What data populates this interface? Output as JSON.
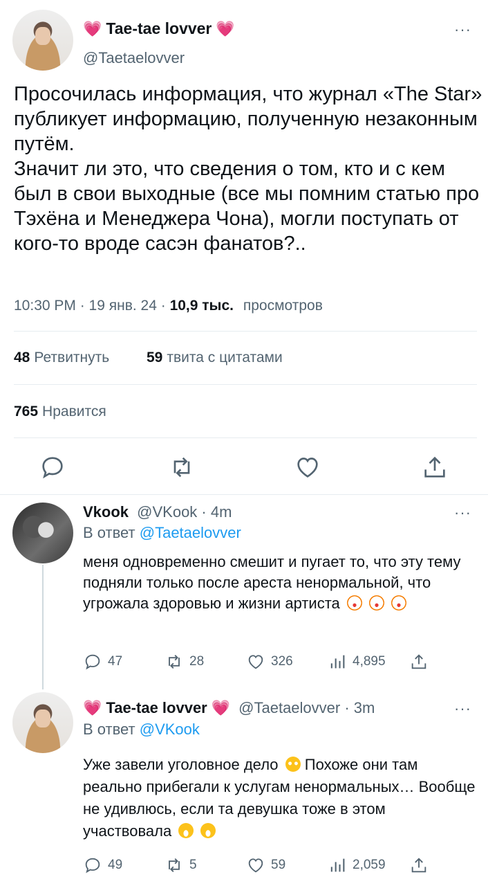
{
  "tweet": {
    "author_name": "Tae-tae lovver",
    "author_handle": "@Taetaelovver",
    "heart_left": "💗",
    "heart_right": "💗",
    "more": "···",
    "text": "Просочилась информация, что журнал «The Star» публикует информацию, полученную незаконным путём.\nЗначит ли это, что сведения о том, кто и с кем был в свои выходные (все мы помним статью про Тэхёна и Менеджера Чона), могли поступать от кого-то вроде сасэн фанатов?..",
    "time": "10:30 PM · 19 янв. 24 · ",
    "views_count": "10,9 тыс.",
    "views_label": "просмотров",
    "retweets_count": "48",
    "retweets_label": "Ретвитнуть",
    "quotes_count": "59",
    "quotes_label": "твита с цитатами",
    "likes_count": "765",
    "likes_label": "Нравится"
  },
  "replies": [
    {
      "author_name": "Vkook",
      "author_handle": "@VKook · 4m",
      "reply_to_prefix": "В ответ ",
      "reply_to": "@Taetaelovver",
      "text": "меня одновременно смешит и пугает то, что эту тему подняли только после ареста ненормальной, что угрожала здоровью и жизни артиста",
      "replies": "47",
      "retweets": "28",
      "likes": "326",
      "views": "4,895"
    },
    {
      "author_name": "Tae-tae lovver",
      "author_handle": "@Taetaelovver · 3m",
      "reply_to_prefix": "В ответ ",
      "reply_to": "@VKook",
      "text_1": "Уже завели уголовное дело",
      "text_2": " Похоже они там реально прибегали к услугам ненормальных… Вообще не удивлюсь, если та девушка тоже в этом участвовала",
      "replies": "49",
      "retweets": "5",
      "likes": "59",
      "views": "2,059"
    }
  ],
  "colors": {
    "text": "#0f1419",
    "muted": "#536471",
    "link": "#1d9bf0",
    "heart": "#f91880",
    "divider": "#e6ecf0"
  },
  "icons": [
    "reply-icon",
    "retweet-icon",
    "like-icon",
    "share-icon",
    "views-icon",
    "more-icon"
  ]
}
